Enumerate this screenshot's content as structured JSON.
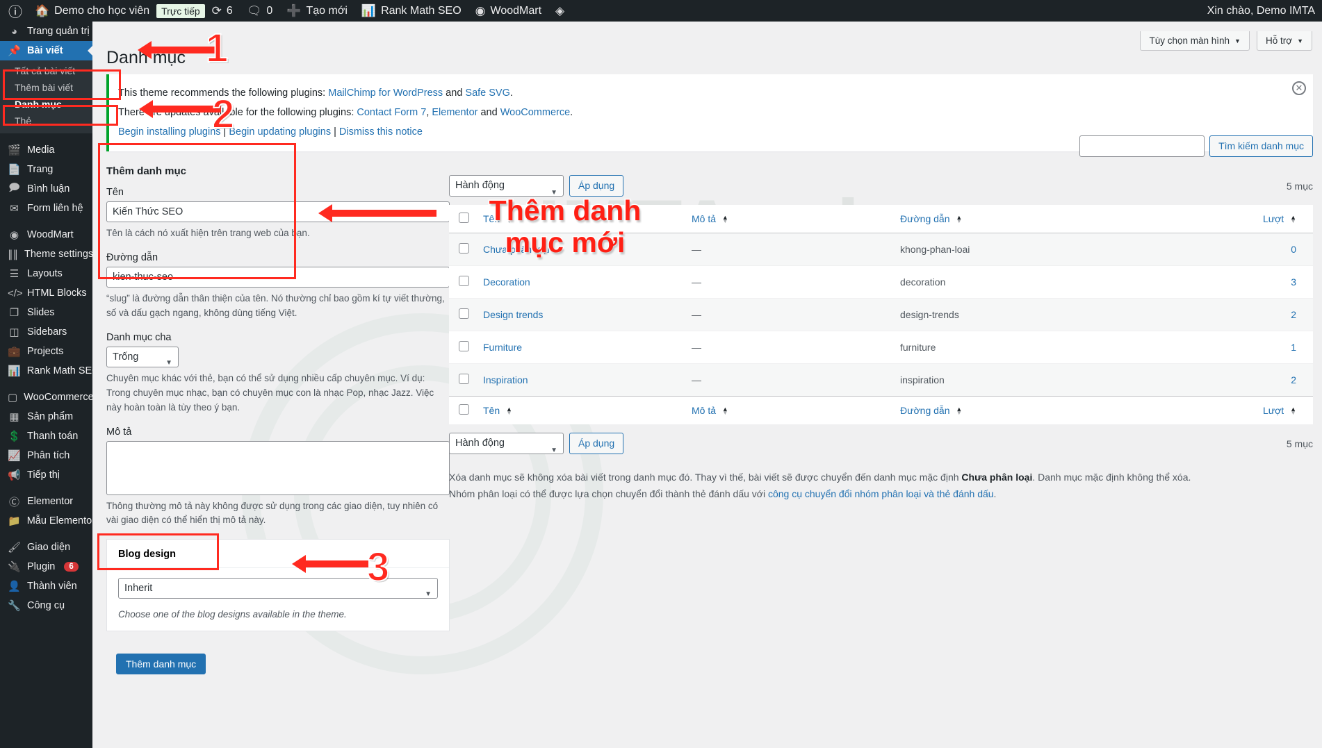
{
  "adminbar": {
    "wp_logo": "wordpress-logo-icon",
    "items": [
      {
        "icon": "home-icon",
        "label": "Demo cho học viên"
      },
      {
        "icon": "updates-icon",
        "label": "6"
      },
      {
        "icon": "comment-icon",
        "label": "0"
      },
      {
        "icon": "plus-icon",
        "label": "Tạo mới"
      },
      {
        "icon": "rankmath-icon",
        "label": "Rank Math SEO"
      },
      {
        "icon": "woodmart-icon",
        "label": "WoodMart"
      },
      {
        "icon": "elementor-icon",
        "label": ""
      }
    ],
    "live_badge": "Trực tiếp",
    "greeting": "Xin chào, Demo IMTA"
  },
  "sidebar": {
    "items": [
      {
        "icon": "dashboard-icon",
        "label": "Trang quản trị",
        "active": false,
        "separator": false
      },
      {
        "icon": "pin-icon",
        "label": "Bài viết",
        "active": true,
        "separator": false
      },
      {
        "icon": "media-icon",
        "label": "Media",
        "active": false,
        "separator": true
      },
      {
        "icon": "page-icon",
        "label": "Trang",
        "active": false,
        "separator": false
      },
      {
        "icon": "comments-icon",
        "label": "Bình luận",
        "active": false,
        "separator": false
      },
      {
        "icon": "envelope-icon",
        "label": "Form liên hệ",
        "active": false,
        "separator": false
      },
      {
        "icon": "woodmart-icon",
        "label": "WoodMart",
        "active": false,
        "separator": true
      },
      {
        "icon": "sliders-icon",
        "label": "Theme settings",
        "active": false,
        "separator": false
      },
      {
        "icon": "layers-icon",
        "label": "Layouts",
        "active": false,
        "separator": false
      },
      {
        "icon": "code-icon",
        "label": "HTML Blocks",
        "active": false,
        "separator": false
      },
      {
        "icon": "slides-icon",
        "label": "Slides",
        "active": false,
        "separator": false
      },
      {
        "icon": "sidebars-icon",
        "label": "Sidebars",
        "active": false,
        "separator": false
      },
      {
        "icon": "projects-icon",
        "label": "Projects",
        "active": false,
        "separator": false
      },
      {
        "icon": "rankmath-icon",
        "label": "Rank Math SEO",
        "active": false,
        "separator": false
      },
      {
        "icon": "woocommerce-icon",
        "label": "WooCommerce",
        "active": false,
        "separator": true
      },
      {
        "icon": "products-icon",
        "label": "Sản phẩm",
        "active": false,
        "separator": false
      },
      {
        "icon": "payment-icon",
        "label": "Thanh toán",
        "active": false,
        "separator": false
      },
      {
        "icon": "analytics-icon",
        "label": "Phân tích",
        "active": false,
        "separator": false
      },
      {
        "icon": "megaphone-icon",
        "label": "Tiếp thị",
        "active": false,
        "separator": false
      },
      {
        "icon": "elementor-icon",
        "label": "Elementor",
        "active": false,
        "separator": true
      },
      {
        "icon": "folder-icon",
        "label": "Mẫu Elementor",
        "active": false,
        "separator": false
      },
      {
        "icon": "brush-icon",
        "label": "Giao diện",
        "active": false,
        "separator": true
      },
      {
        "icon": "plug-icon",
        "label": "Plugin",
        "active": false,
        "separator": false,
        "badge": "6"
      },
      {
        "icon": "user-icon",
        "label": "Thành viên",
        "active": false,
        "separator": false
      },
      {
        "icon": "wrench-icon",
        "label": "Công cụ",
        "active": false,
        "separator": false
      }
    ],
    "posts_submenu": [
      {
        "label": "Tất cả bài viết",
        "current": false
      },
      {
        "label": "Thêm bài viết",
        "current": false
      },
      {
        "label": "Danh mục",
        "current": true
      },
      {
        "label": "Thẻ",
        "current": false
      }
    ]
  },
  "screen_meta": {
    "screen_options": "Tùy chọn màn hình",
    "help": "Hỗ trợ"
  },
  "page": {
    "title": "Danh mục"
  },
  "notice": {
    "line1_pre": "This theme recommends the following plugins: ",
    "line1_link1": "MailChimp for WordPress",
    "line1_and": " and ",
    "line1_link2": "Safe SVG",
    "line1_end": ".",
    "line2_pre": "There are updates available for the following plugins: ",
    "line2_link1": "Contact Form 7",
    "line2_sep": ", ",
    "line2_link2": "Elementor",
    "line2_and": " and ",
    "line2_link3": "WooCommerce",
    "line2_end": ".",
    "action1": "Begin installing plugins",
    "action2": "Begin updating plugins",
    "action3": "Dismiss this notice",
    "dismiss_icon": "close-icon"
  },
  "form": {
    "heading": "Thêm danh mục",
    "name_label": "Tên",
    "name_value": "Kiến Thức SEO",
    "name_help": "Tên là cách nó xuất hiện trên trang web của bạn.",
    "slug_label": "Đường dẫn",
    "slug_value": "kien-thuc-seo",
    "slug_help": "“slug” là đường dẫn thân thiện của tên. Nó thường chỉ bao gồm kí tự viết thường, số và dấu gạch ngang, không dùng tiếng Việt.",
    "parent_label": "Danh mục cha",
    "parent_value": "Trống",
    "parent_help": "Chuyên mục khác với thẻ, bạn có thể sử dụng nhiều cấp chuyên mục. Ví dụ: Trong chuyên mục nhạc, bạn có chuyên mục con là nhạc Pop, nhạc Jazz. Việc này hoàn toàn là tùy theo ý bạn.",
    "desc_label": "Mô tả",
    "desc_value": "",
    "desc_help": "Thông thường mô tả này không được sử dụng trong các giao diện, tuy nhiên có vài giao diện có thể hiển thị mô tả này.",
    "blog_design_title": "Blog design",
    "blog_design_value": "Inherit",
    "blog_design_note": "Choose one of the blog designs available in the theme.",
    "submit_label": "Thêm danh mục"
  },
  "list": {
    "search_value": "",
    "search_button": "Tìm kiếm danh mục",
    "bulk_action_value": "Hành động",
    "apply_label": "Áp dụng",
    "count_top": "5 mục",
    "count_bottom": "5 mục",
    "columns": [
      {
        "key": "name",
        "label": "Tên"
      },
      {
        "key": "description",
        "label": "Mô tả"
      },
      {
        "key": "slug",
        "label": "Đường dẫn"
      },
      {
        "key": "count",
        "label": "Lượt"
      }
    ],
    "rows": [
      {
        "name": "Chưa phân loại",
        "description": "—",
        "slug": "khong-phan-loai",
        "count": "0"
      },
      {
        "name": "Decoration",
        "description": "—",
        "slug": "decoration",
        "count": "3"
      },
      {
        "name": "Design trends",
        "description": "—",
        "slug": "design-trends",
        "count": "2"
      },
      {
        "name": "Furniture",
        "description": "—",
        "slug": "furniture",
        "count": "1"
      },
      {
        "name": "Inspiration",
        "description": "—",
        "slug": "inspiration",
        "count": "2"
      }
    ],
    "footnote1_pre": "Xóa danh mục sẽ không xóa bài viết trong danh mục đó. Thay vì thế, bài viết sẽ được chuyển đến danh mục mặc định ",
    "footnote1_bold": "Chưa phân loại",
    "footnote1_post": ". Danh mục mặc định không thể xóa.",
    "footnote2_pre": "Nhóm phân loại có thể được lựa chọn chuyển đổi thành thẻ đánh dấu với ",
    "footnote2_link": "công cụ chuyển đổi nhóm phân loại và thẻ đánh dấu",
    "footnote2_post": "."
  },
  "annotations": {
    "step1": "1",
    "step2": "2",
    "step3": "3",
    "overlay_line1": "Thêm danh",
    "overlay_line2": "mục mới",
    "color": "#ff2a20"
  }
}
